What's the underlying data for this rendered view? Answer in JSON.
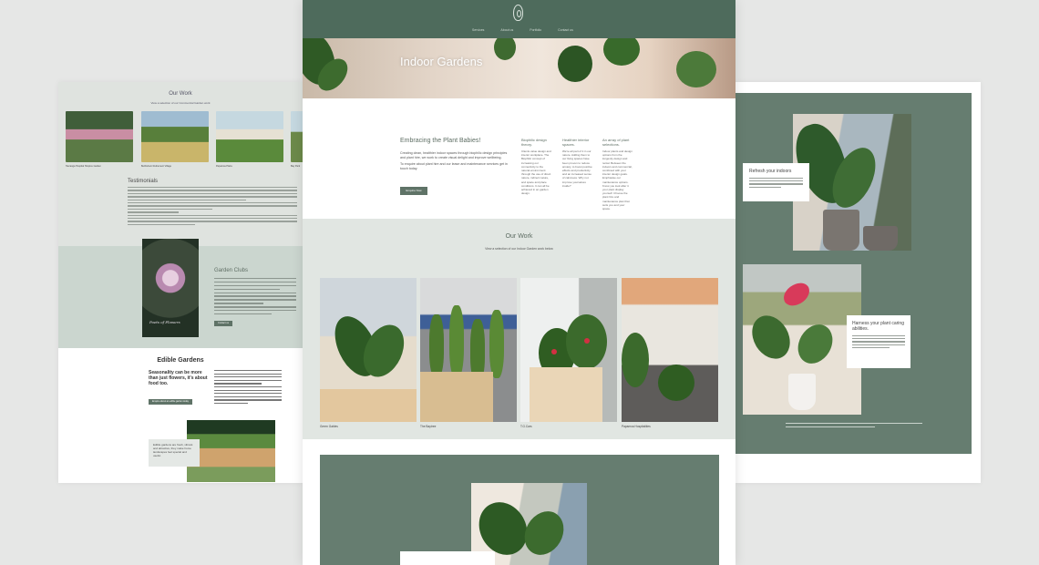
{
  "left": {
    "work_title": "Our Work",
    "work_sub": "View a selection of our Commercial Garden work",
    "thumb_captions": [
      "Tauranga Hospital Hospice Garden",
      "Bethlehem Retirement Village",
      "Papamoa Plaza",
      "Bay Park"
    ],
    "testimonials_title": "Testimonials",
    "clubs_title": "Garden Clubs",
    "clubs_button": "Contact us",
    "photo_script": "Poets of Flowers",
    "edible_title": "Edible Gardens",
    "edible_lead": "Seasonality can be more than just flowers, it's about food too.",
    "edible_button": "Enquire about an edible garden today",
    "bed_card": "Edible gardens are fresh, vibrant and attractive, they make home landscapes feel special and useful."
  },
  "center": {
    "nav_items": [
      "Services",
      "About us",
      "Portfolio",
      "Contact us"
    ],
    "hero_title": "Indoor Gardens",
    "intro_title": "Embracing the Plant Babies!",
    "intro_text": "Creating clean, healthier indoor spaces through biophilic design principles and plant hire, we work to create visual delight and improve wellbeing.",
    "intro_text2": "To enquire about plant hire and our lease and maintenance services get in touch today.",
    "intro_button": "Enquire Now",
    "columns": [
      {
        "title": "Biophilic design theory.",
        "body": "Clients value design and interior workplace. The Biophilic concept of increasing our connectivity to the natural environment through the use of direct nature, indirect nature, and space and place conditions. It can all be achieved in an garden design."
      },
      {
        "title": "Healthier interior spaces.",
        "body": "We're all part of it in our nature. Adding them to our living spaces have been proven to reduce anxiety, to boost positive effects and productivity and an increased sense of calmness. Why not improve yourselves inside?"
      },
      {
        "title": "An array of plant selections.",
        "body": "Indoor plants and design options from the longevity design and rental. Between the indoors and commercial, combined with your interior design goals. Emphasise our maintenance options. Know you look after it your plant display yourself. Choose the plant hire and maintenance plan that suits you and your space."
      }
    ],
    "work_title": "Our Work",
    "work_sub": "View a selection of our Indoor Garden work below",
    "thumb_captions": [
      "Green Gables",
      "The Baytree",
      "T.G.Cars",
      "Papamoa Hospitalities"
    ]
  },
  "right": {
    "card1_title": "Refresh your indoors",
    "card2_title": "Harness your plant caring abilities."
  }
}
